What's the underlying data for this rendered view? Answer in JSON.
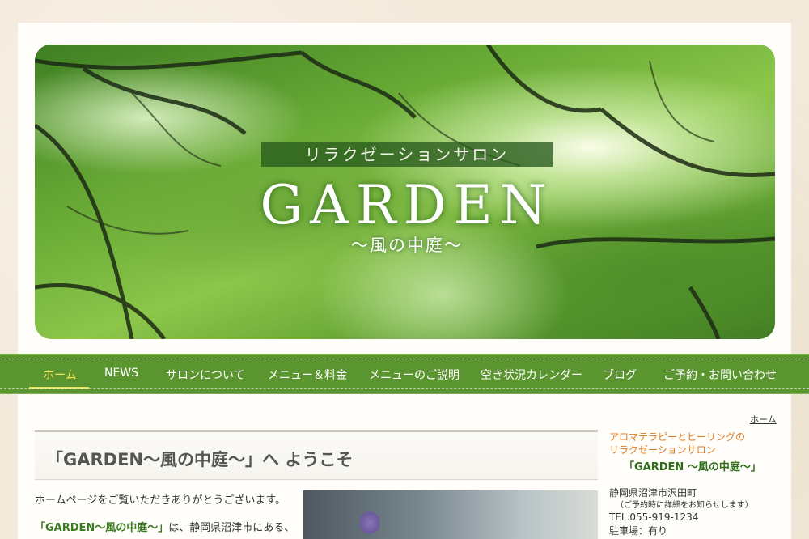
{
  "hero": {
    "subtitle": "リラクゼーションサロン",
    "title": "GARDEN",
    "tagline": "〜風の中庭〜"
  },
  "nav": {
    "items": [
      {
        "label": "ホーム",
        "active": true
      },
      {
        "label": "NEWS"
      },
      {
        "label": "サロンについて"
      },
      {
        "label": "メニュー＆料金"
      },
      {
        "label": "メニューのご説明"
      },
      {
        "label": "空き状況カレンダー"
      },
      {
        "label": "ブログ"
      },
      {
        "label": "ご予約・お問い合わせ"
      }
    ]
  },
  "breadcrumb": "ホーム",
  "main": {
    "headline": "「GARDEN〜風の中庭〜」へ ようこそ",
    "intro": "ホームページをご覧いただきありがとうございます。",
    "intro2_brand": "「GARDEN〜風の中庭〜」",
    "intro2_rest": "は、静岡県沼津市にある、"
  },
  "sidebar": {
    "line1": "アロマテラピーとヒーリングの",
    "line2": "リラクゼーションサロン",
    "brand": "「GARDEN 〜風の中庭〜」",
    "address": "静岡県沼津市沢田町",
    "note": "（ご予約時に詳細をお知らせします）",
    "tel": "TEL.055-919-1234",
    "parking": "駐車場：有り"
  },
  "colors": {
    "nav_bg": "#5b9530",
    "nav_active": "#f3e25a",
    "accent_orange": "#e07a1f",
    "brand_green": "#2f6e19"
  }
}
